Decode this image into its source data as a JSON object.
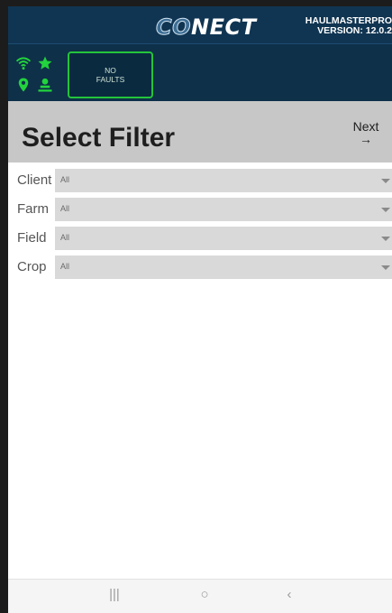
{
  "header": {
    "logo_left": "CO",
    "logo_right": "NECT",
    "product_name": "HAULMASTERPRO",
    "version": "VERSION: 12.0.2",
    "fault_line1": "NO",
    "fault_line2": "FAULTS",
    "status_icons": [
      "wifi-icon",
      "star-icon",
      "location-pin-icon",
      "user-icon"
    ],
    "accent_green": "#22d33d",
    "header_bg": "#0e3049"
  },
  "page": {
    "title": "Select Filter",
    "next_label": "Next",
    "next_arrow": "→"
  },
  "filters": [
    {
      "label": "Client",
      "value": "All"
    },
    {
      "label": "Farm",
      "value": "All"
    },
    {
      "label": "Field",
      "value": "All"
    },
    {
      "label": "Crop",
      "value": "All"
    }
  ],
  "nav": {
    "recent_icon": "|||",
    "home_icon": "○",
    "back_icon": "‹"
  }
}
